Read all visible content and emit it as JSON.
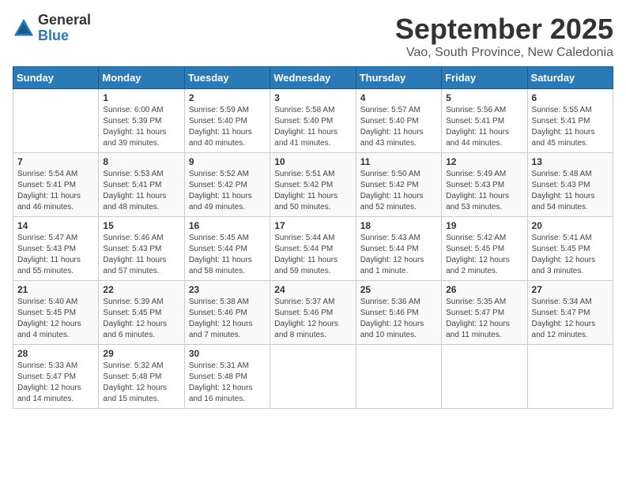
{
  "logo": {
    "general": "General",
    "blue": "Blue"
  },
  "header": {
    "month": "September 2025",
    "location": "Vao, South Province, New Caledonia"
  },
  "weekdays": [
    "Sunday",
    "Monday",
    "Tuesday",
    "Wednesday",
    "Thursday",
    "Friday",
    "Saturday"
  ],
  "weeks": [
    [
      {
        "day": "",
        "content": ""
      },
      {
        "day": "1",
        "content": "Sunrise: 6:00 AM\nSunset: 5:39 PM\nDaylight: 11 hours\nand 39 minutes."
      },
      {
        "day": "2",
        "content": "Sunrise: 5:59 AM\nSunset: 5:40 PM\nDaylight: 11 hours\nand 40 minutes."
      },
      {
        "day": "3",
        "content": "Sunrise: 5:58 AM\nSunset: 5:40 PM\nDaylight: 11 hours\nand 41 minutes."
      },
      {
        "day": "4",
        "content": "Sunrise: 5:57 AM\nSunset: 5:40 PM\nDaylight: 11 hours\nand 43 minutes."
      },
      {
        "day": "5",
        "content": "Sunrise: 5:56 AM\nSunset: 5:41 PM\nDaylight: 11 hours\nand 44 minutes."
      },
      {
        "day": "6",
        "content": "Sunrise: 5:55 AM\nSunset: 5:41 PM\nDaylight: 11 hours\nand 45 minutes."
      }
    ],
    [
      {
        "day": "7",
        "content": "Sunrise: 5:54 AM\nSunset: 5:41 PM\nDaylight: 11 hours\nand 46 minutes."
      },
      {
        "day": "8",
        "content": "Sunrise: 5:53 AM\nSunset: 5:41 PM\nDaylight: 11 hours\nand 48 minutes."
      },
      {
        "day": "9",
        "content": "Sunrise: 5:52 AM\nSunset: 5:42 PM\nDaylight: 11 hours\nand 49 minutes."
      },
      {
        "day": "10",
        "content": "Sunrise: 5:51 AM\nSunset: 5:42 PM\nDaylight: 11 hours\nand 50 minutes."
      },
      {
        "day": "11",
        "content": "Sunrise: 5:50 AM\nSunset: 5:42 PM\nDaylight: 11 hours\nand 52 minutes."
      },
      {
        "day": "12",
        "content": "Sunrise: 5:49 AM\nSunset: 5:43 PM\nDaylight: 11 hours\nand 53 minutes."
      },
      {
        "day": "13",
        "content": "Sunrise: 5:48 AM\nSunset: 5:43 PM\nDaylight: 11 hours\nand 54 minutes."
      }
    ],
    [
      {
        "day": "14",
        "content": "Sunrise: 5:47 AM\nSunset: 5:43 PM\nDaylight: 11 hours\nand 55 minutes."
      },
      {
        "day": "15",
        "content": "Sunrise: 5:46 AM\nSunset: 5:43 PM\nDaylight: 11 hours\nand 57 minutes."
      },
      {
        "day": "16",
        "content": "Sunrise: 5:45 AM\nSunset: 5:44 PM\nDaylight: 11 hours\nand 58 minutes."
      },
      {
        "day": "17",
        "content": "Sunrise: 5:44 AM\nSunset: 5:44 PM\nDaylight: 11 hours\nand 59 minutes."
      },
      {
        "day": "18",
        "content": "Sunrise: 5:43 AM\nSunset: 5:44 PM\nDaylight: 12 hours\nand 1 minute."
      },
      {
        "day": "19",
        "content": "Sunrise: 5:42 AM\nSunset: 5:45 PM\nDaylight: 12 hours\nand 2 minutes."
      },
      {
        "day": "20",
        "content": "Sunrise: 5:41 AM\nSunset: 5:45 PM\nDaylight: 12 hours\nand 3 minutes."
      }
    ],
    [
      {
        "day": "21",
        "content": "Sunrise: 5:40 AM\nSunset: 5:45 PM\nDaylight: 12 hours\nand 4 minutes."
      },
      {
        "day": "22",
        "content": "Sunrise: 5:39 AM\nSunset: 5:45 PM\nDaylight: 12 hours\nand 6 minutes."
      },
      {
        "day": "23",
        "content": "Sunrise: 5:38 AM\nSunset: 5:46 PM\nDaylight: 12 hours\nand 7 minutes."
      },
      {
        "day": "24",
        "content": "Sunrise: 5:37 AM\nSunset: 5:46 PM\nDaylight: 12 hours\nand 8 minutes."
      },
      {
        "day": "25",
        "content": "Sunrise: 5:36 AM\nSunset: 5:46 PM\nDaylight: 12 hours\nand 10 minutes."
      },
      {
        "day": "26",
        "content": "Sunrise: 5:35 AM\nSunset: 5:47 PM\nDaylight: 12 hours\nand 11 minutes."
      },
      {
        "day": "27",
        "content": "Sunrise: 5:34 AM\nSunset: 5:47 PM\nDaylight: 12 hours\nand 12 minutes."
      }
    ],
    [
      {
        "day": "28",
        "content": "Sunrise: 5:33 AM\nSunset: 5:47 PM\nDaylight: 12 hours\nand 14 minutes."
      },
      {
        "day": "29",
        "content": "Sunrise: 5:32 AM\nSunset: 5:48 PM\nDaylight: 12 hours\nand 15 minutes."
      },
      {
        "day": "30",
        "content": "Sunrise: 5:31 AM\nSunset: 5:48 PM\nDaylight: 12 hours\nand 16 minutes."
      },
      {
        "day": "",
        "content": ""
      },
      {
        "day": "",
        "content": ""
      },
      {
        "day": "",
        "content": ""
      },
      {
        "day": "",
        "content": ""
      }
    ]
  ]
}
